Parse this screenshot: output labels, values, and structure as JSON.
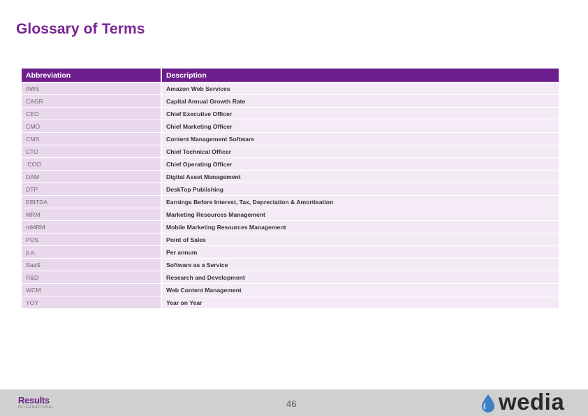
{
  "title": "Glossary of Terms",
  "table": {
    "headers": [
      "Abbreviation",
      "Description"
    ],
    "rows": [
      {
        "abbr": "AWS",
        "desc": "Amazon Web Services"
      },
      {
        "abbr": "CAGR",
        "desc": "Capital Annual Growth Rate"
      },
      {
        "abbr": "CEO",
        "desc": "Chief Executive Officer"
      },
      {
        "abbr": "CMO",
        "desc": "Chief Marketing Officer"
      },
      {
        "abbr": "CMS",
        "desc": "Content Management Software"
      },
      {
        "abbr": "CTO",
        "desc": "Chief Technical Officer"
      },
      {
        "abbr": " COO",
        "desc": "Chief Operating Officer"
      },
      {
        "abbr": "DAM",
        "desc": "Digital Asset Management"
      },
      {
        "abbr": "DTP",
        "desc": "DeskTop Publishing"
      },
      {
        "abbr": "EBITDA",
        "desc": "Earnings Before Interest, Tax, Depreciation & Amortisation"
      },
      {
        "abbr": "MRM",
        "desc": "Marketing Resources Management"
      },
      {
        "abbr": "mMRM",
        "desc": "Mobile Marketing Resources Management"
      },
      {
        "abbr": "POS",
        "desc": "Point of Sales"
      },
      {
        "abbr": "p.a.",
        "desc": "Per annum"
      },
      {
        "abbr": "SaaS",
        "desc": "Software as a Service"
      },
      {
        "abbr": "R&D",
        "desc": "Research and Development"
      },
      {
        "abbr": "WCM",
        "desc": "Web Content Management"
      },
      {
        "abbr": "YOY",
        "desc": "Year on Year"
      }
    ]
  },
  "footer": {
    "results_logo": "Results",
    "results_logo_sub": "INTERNATIONAL",
    "page_number": "46",
    "wedia_logo": "wedia"
  },
  "colors": {
    "title": "#7b2393",
    "header_bg": "#6d1f8d",
    "abbr_bg": "#e9d8ec",
    "desc_bg": "#f3eaf5",
    "footer_bg": "#d0d0d0",
    "wedia_drop": "#3f7fc4"
  }
}
